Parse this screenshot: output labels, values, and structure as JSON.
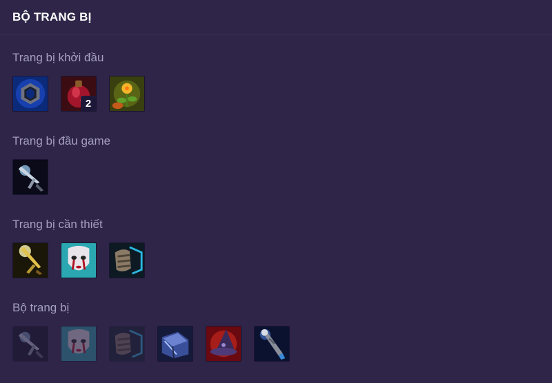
{
  "header": {
    "title": "BỘ TRANG BỊ"
  },
  "sections": [
    {
      "title": "Trang bị khởi đầu",
      "items": [
        {
          "icon": "ring-icon"
        },
        {
          "icon": "potion-icon",
          "count": "2"
        },
        {
          "icon": "flower-icon"
        }
      ]
    },
    {
      "title": "Trang bị đầu game",
      "items": [
        {
          "icon": "blade-icon"
        }
      ]
    },
    {
      "title": "Trang bị cần thiết",
      "items": [
        {
          "icon": "golden-sword-icon"
        },
        {
          "icon": "mask-icon"
        },
        {
          "icon": "boots-icon"
        }
      ]
    },
    {
      "title": "Bộ trang bị",
      "items": [
        {
          "icon": "blade-icon",
          "dimmed": true
        },
        {
          "icon": "mask-icon",
          "dimmed": true
        },
        {
          "icon": "boots-icon",
          "dimmed": true
        },
        {
          "icon": "book-icon"
        },
        {
          "icon": "hat-icon"
        },
        {
          "icon": "staff-icon"
        }
      ]
    }
  ]
}
